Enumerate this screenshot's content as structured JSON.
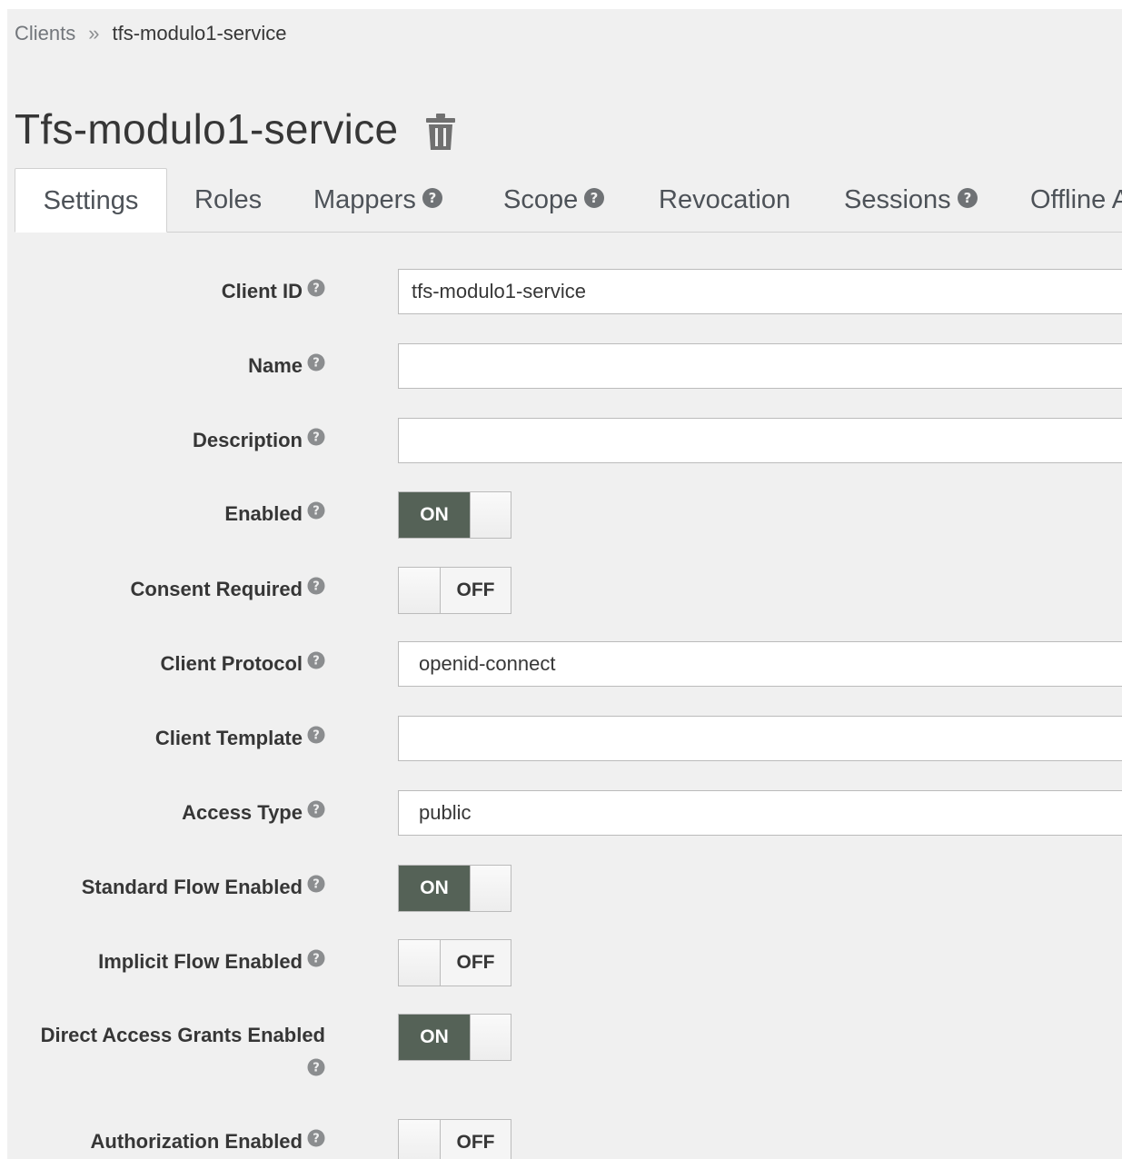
{
  "breadcrumb": {
    "root": "Clients",
    "separator": "»",
    "current": "tfs-modulo1-service"
  },
  "title": "Tfs-modulo1-service",
  "tabs": [
    {
      "label": "Settings",
      "help": false,
      "active": true
    },
    {
      "label": "Roles",
      "help": false,
      "active": false
    },
    {
      "label": "Mappers",
      "help": true,
      "active": false
    },
    {
      "label": "Scope",
      "help": true,
      "active": false
    },
    {
      "label": "Revocation",
      "help": false,
      "active": false
    },
    {
      "label": "Sessions",
      "help": true,
      "active": false
    },
    {
      "label": "Offline Access",
      "help": true,
      "active": false
    }
  ],
  "form": {
    "client_id": {
      "label": "Client ID",
      "value": "tfs-modulo1-service"
    },
    "name": {
      "label": "Name",
      "value": ""
    },
    "description": {
      "label": "Description",
      "value": ""
    },
    "enabled": {
      "label": "Enabled",
      "state": "ON"
    },
    "consent_required": {
      "label": "Consent Required",
      "state": "OFF"
    },
    "client_protocol": {
      "label": "Client Protocol",
      "value": "openid-connect"
    },
    "client_template": {
      "label": "Client Template",
      "value": ""
    },
    "access_type": {
      "label": "Access Type",
      "value": "public"
    },
    "standard_flow": {
      "label": "Standard Flow Enabled",
      "state": "ON"
    },
    "implicit_flow": {
      "label": "Implicit Flow Enabled",
      "state": "OFF"
    },
    "direct_access": {
      "label": "Direct Access Grants Enabled",
      "state": "ON"
    },
    "authorization": {
      "label": "Authorization Enabled",
      "state": "OFF"
    }
  },
  "colors": {
    "switch_on_bg": "#556257",
    "panel_bg": "#f0f0f0",
    "help_icon": "#8b8d8f"
  }
}
